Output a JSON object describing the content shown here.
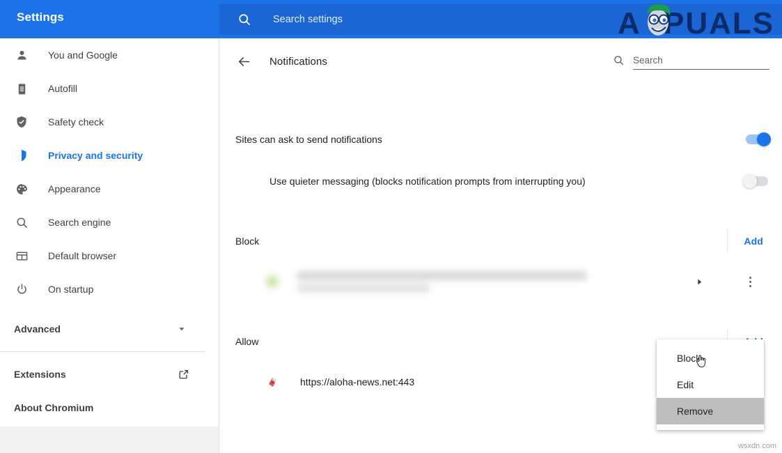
{
  "app": {
    "title": "Settings",
    "watermark_logo": "APPUALS",
    "watermark_bottom": "wsxdn.com",
    "accent_color": "#1a73e8",
    "topbar_color": "#1a73e8"
  },
  "topsearch": {
    "icon": "search-icon",
    "placeholder": "Search settings",
    "value": ""
  },
  "sidebar": {
    "items": [
      {
        "label": "You and Google",
        "icon": "person-icon",
        "active": false
      },
      {
        "label": "Autofill",
        "icon": "clipboard-icon",
        "active": false
      },
      {
        "label": "Safety check",
        "icon": "shield-check-icon",
        "active": false
      },
      {
        "label": "Privacy and security",
        "icon": "shield-half-icon",
        "active": true
      },
      {
        "label": "Appearance",
        "icon": "palette-icon",
        "active": false
      },
      {
        "label": "Search engine",
        "icon": "search-icon",
        "active": false
      },
      {
        "label": "Default browser",
        "icon": "browser-window-icon",
        "active": false
      },
      {
        "label": "On startup",
        "icon": "power-icon",
        "active": false
      }
    ],
    "advanced": {
      "label": "Advanced",
      "icon": "chevron-down-icon"
    },
    "footer": [
      {
        "label": "Extensions",
        "icon": "external-link-icon"
      },
      {
        "label": "About Chromium",
        "icon": ""
      }
    ]
  },
  "main": {
    "back_icon": "arrow-left-icon",
    "title": "Notifications",
    "search": {
      "icon": "search-icon",
      "placeholder": "Search",
      "value": ""
    },
    "settings": [
      {
        "label": "Sites can ask to send notifications",
        "toggle": "on",
        "indent": false
      },
      {
        "label": "Use quieter messaging (blocks notification prompts from interrupting you)",
        "toggle": "off",
        "indent": true
      }
    ],
    "groups": [
      {
        "label": "Block",
        "add_label": "Add",
        "rows": [
          {
            "redacted": true,
            "url": "",
            "expand_icon": "triangle-right-icon",
            "kebab_icon": "more-vertical-icon"
          }
        ]
      },
      {
        "label": "Allow",
        "add_label": "Add",
        "rows": [
          {
            "redacted": false,
            "url": "https://aloha-news.net:443",
            "favicon": "site-favicon"
          }
        ]
      }
    ]
  },
  "context_menu": {
    "items": [
      {
        "label": "Block",
        "highlighted": false
      },
      {
        "label": "Edit",
        "highlighted": false
      },
      {
        "label": "Remove",
        "highlighted": true
      }
    ],
    "cursor": "pointing-hand-cursor"
  }
}
